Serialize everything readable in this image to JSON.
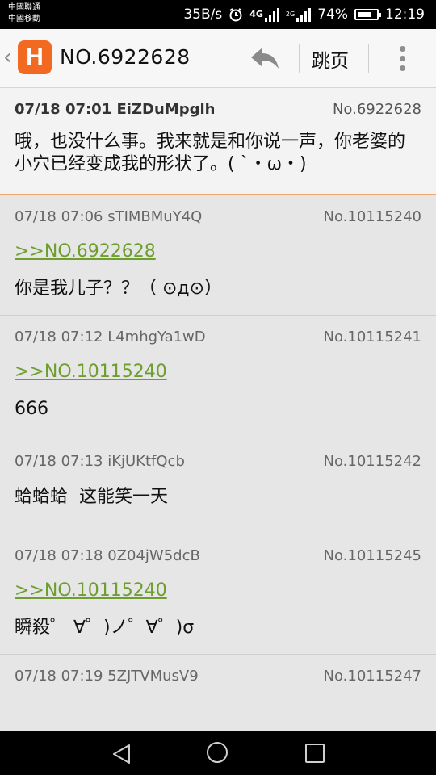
{
  "status_bar": {
    "carrier_1": "中國聯通",
    "carrier_2": "中國移動",
    "speed": "35B/s",
    "network_4g": "4G",
    "network_2g": "2G",
    "battery": "74%",
    "battery_level": 0.74,
    "time": "12:19"
  },
  "app_bar": {
    "logo_letter": "H",
    "title": "NO.6922628",
    "jump_label": "跳页"
  },
  "colors": {
    "accent": "#f26a21",
    "quote_link": "#6e9e2e",
    "op_divider": "#f0a66e"
  },
  "original_post": {
    "datetime": "07/18 07:01",
    "user_id": "EiZDuMpglh",
    "number": "No.6922628",
    "text": "哦，也没什么事。我来就是和你说一声，你老婆的小穴已经变成我的形状了。( `・ω・)"
  },
  "replies": [
    {
      "datetime": "07/18 07:06",
      "user_id": "sTIMBMuY4Q",
      "number": "No.10115240",
      "quote": ">>NO.6922628",
      "text": "你是我儿子？？（ ⊙д⊙）"
    },
    {
      "datetime": "07/18 07:12",
      "user_id": "L4mhgYa1wD",
      "number": "No.10115241",
      "quote": ">>NO.10115240",
      "text": "666"
    },
    {
      "datetime": "07/18 07:13",
      "user_id": "iKjUKtfQcb",
      "number": "No.10115242",
      "quote": "",
      "text": "蛤蛤蛤  这能笑一天"
    },
    {
      "datetime": "07/18 07:18",
      "user_id": "0Z04jW5dcB",
      "number": "No.10115245",
      "quote": ">>NO.10115240",
      "text": "瞬殺゜ ∀゜)ノ゜∀゜)σ"
    },
    {
      "datetime": "07/18 07:19",
      "user_id": "5ZJTVMusV9",
      "number": "No.10115247",
      "quote": "",
      "text": ""
    }
  ]
}
